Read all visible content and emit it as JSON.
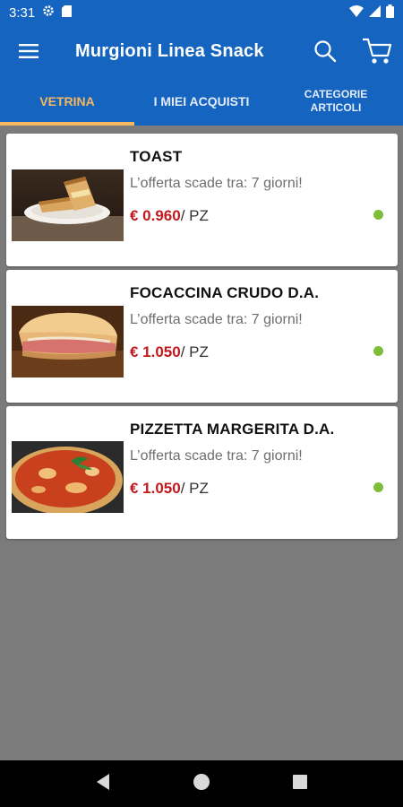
{
  "status": {
    "time": "3:31"
  },
  "app": {
    "title": "Murgioni Linea Snack"
  },
  "tabs": [
    {
      "label": "VETRINA"
    },
    {
      "label": "I MIEI ACQUISTI"
    },
    {
      "label_line1": "CATEGORIE",
      "label_line2": "ARTICOLI"
    }
  ],
  "products": [
    {
      "name": "TOAST",
      "offer": "L’offerta scade tra: 7 giorni!",
      "price": "€ 0.960",
      "unit": "/ PZ"
    },
    {
      "name": "FOCACCINA CRUDO D.A.",
      "offer": "L’offerta scade tra: 7 giorni!",
      "price": "€ 1.050",
      "unit": "/ PZ"
    },
    {
      "name": "PIZZETTA MARGERITA D.A.",
      "offer": "L’offerta scade tra: 7 giorni!",
      "price": "€ 1.050",
      "unit": "/ PZ"
    }
  ],
  "colors": {
    "primary": "#1565c0",
    "accent": "#f5b860",
    "price": "#c2181f",
    "available": "#7cbd3a"
  }
}
